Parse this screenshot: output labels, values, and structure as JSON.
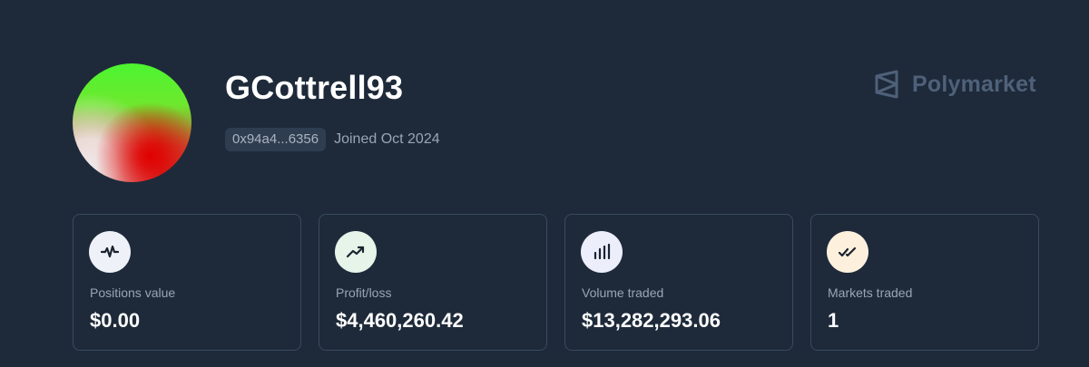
{
  "profile": {
    "username": "GCottrell93",
    "address": "0x94a4...6356",
    "joined": "Joined Oct 2024"
  },
  "brand": {
    "name": "Polymarket",
    "icon": "polymarket-logo-icon"
  },
  "stats": [
    {
      "label": "Positions value",
      "value": "$0.00",
      "icon": "activity-pulse-icon",
      "icon_bg": "#eef1f7"
    },
    {
      "label": "Profit/loss",
      "value": "$4,460,260.42",
      "icon": "trending-up-icon",
      "icon_bg": "#e6f4e9"
    },
    {
      "label": "Volume traded",
      "value": "$13,282,293.06",
      "icon": "bar-chart-icon",
      "icon_bg": "#eceefb"
    },
    {
      "label": "Markets traded",
      "value": "1",
      "icon": "double-check-icon",
      "icon_bg": "#fdf1de"
    }
  ],
  "colors": {
    "background": "#1e2a3a",
    "card_border": "#3a4a5e",
    "muted_text": "#9aa5b3",
    "brand_color": "#4f6179"
  }
}
